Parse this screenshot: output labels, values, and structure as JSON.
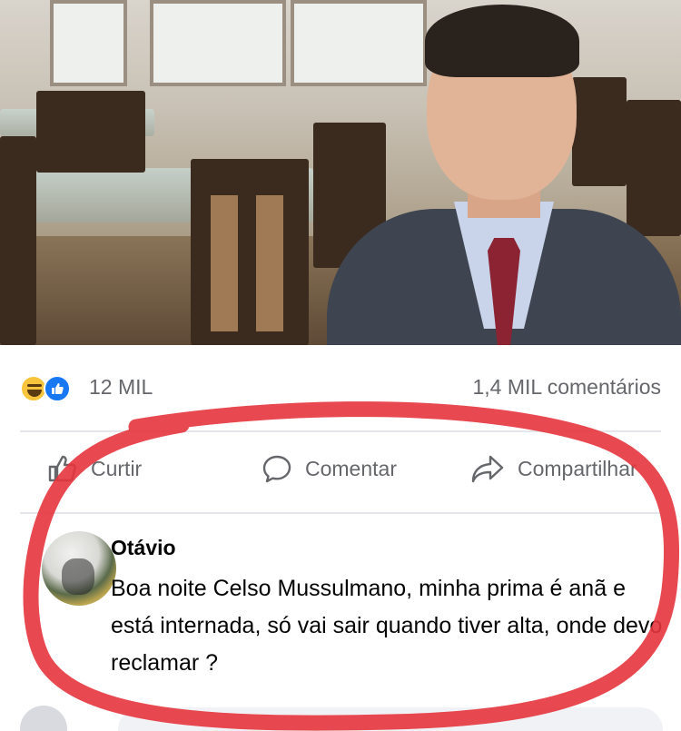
{
  "post": {
    "reaction_count": "12 MIL",
    "comment_count": "1,4 MIL comentários",
    "reaction_icons": [
      "haha-icon",
      "like-icon"
    ]
  },
  "actions": {
    "like_label": "Curtir",
    "comment_label": "Comentar",
    "share_label": "Compartilhar"
  },
  "comment": {
    "author": "Otávio",
    "text": "Boa noite Celso Mussulmano, minha prima é anã e está internada, só vai sair quando tiver alta, onde devo reclamar ?"
  },
  "colors": {
    "annotation_red": "#e5343c",
    "like_blue": "#1877f2",
    "haha_yellow": "#f7c43b"
  }
}
